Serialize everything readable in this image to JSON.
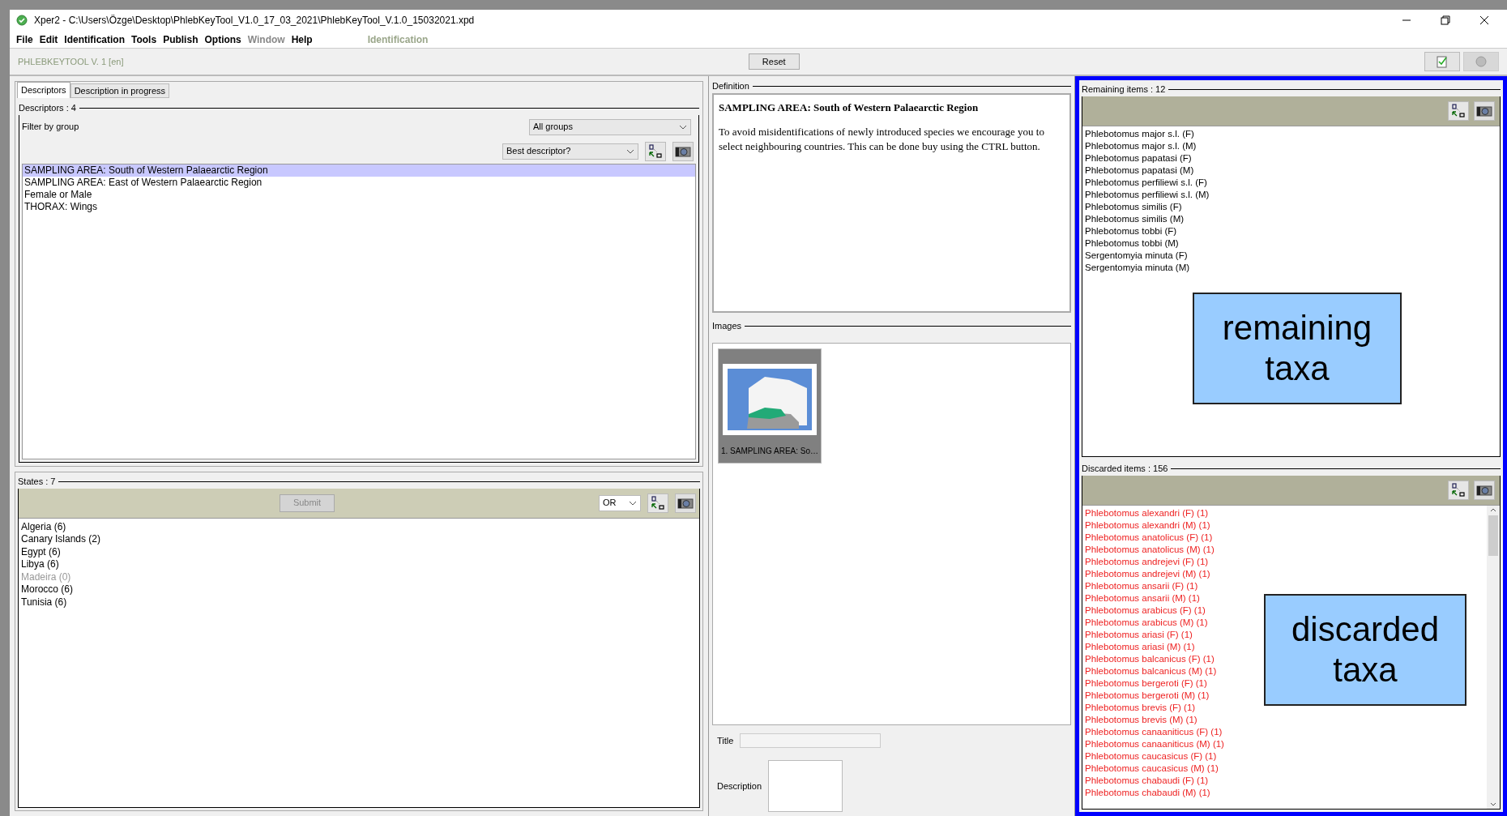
{
  "window": {
    "title": "Xper2 - C:\\Users\\Özge\\Desktop\\PhlebKeyTool_V1.0_17_03_2021\\PhlebKeyTool_V.1.0_15032021.xpd"
  },
  "menu": [
    {
      "label": "File",
      "disabled": false
    },
    {
      "label": "Edit",
      "disabled": false
    },
    {
      "label": "Identification",
      "disabled": false
    },
    {
      "label": "Tools",
      "disabled": false
    },
    {
      "label": "Publish",
      "disabled": false
    },
    {
      "label": "Options",
      "disabled": false
    },
    {
      "label": "Window",
      "disabled": true
    },
    {
      "label": "Help",
      "disabled": false
    }
  ],
  "mode": "Identification",
  "toolbar": {
    "project": "PHLEBKEYTOOL V. 1 [en]",
    "reset": "Reset"
  },
  "tabs": [
    {
      "label": "Descriptors",
      "selected": true
    },
    {
      "label": "Description in progress",
      "selected": false
    }
  ],
  "descriptors": {
    "legend": "Descriptors : 4",
    "filter_label": "Filter by group",
    "group_select": "All groups",
    "sort_select": "Best descriptor?",
    "items": [
      {
        "label": "SAMPLING AREA: South of Western Palaearctic Region",
        "selected": true
      },
      {
        "label": "SAMPLING AREA: East of Western Palaearctic Region",
        "selected": false
      },
      {
        "label": "Female or Male",
        "selected": false
      },
      {
        "label": "THORAX: Wings",
        "selected": false
      }
    ]
  },
  "states": {
    "legend": "States : 7",
    "submit": {
      "label": "Submit",
      "disabled": true
    },
    "operator": "OR",
    "items": [
      {
        "label": "Algeria (6)",
        "disabled": false
      },
      {
        "label": "Canary Islands (2)",
        "disabled": false
      },
      {
        "label": "Egypt (6)",
        "disabled": false
      },
      {
        "label": "Libya (6)",
        "disabled": false
      },
      {
        "label": "Madeira (0)",
        "disabled": true
      },
      {
        "label": "Morocco (6)",
        "disabled": false
      },
      {
        "label": "Tunisia (6)",
        "disabled": false
      }
    ]
  },
  "definition": {
    "legend": "Definition",
    "heading": "SAMPLING AREA: South of Western Palaearctic Region",
    "body": "To avoid misidentifications of newly introduced species we encourage you to select neighbouring countries. This can be done buy using the CTRL button."
  },
  "images": {
    "legend": "Images",
    "thumbnails": [
      {
        "caption": "1. SAMPLING AREA: So…"
      }
    ],
    "title_label": "Title",
    "description_label": "Description"
  },
  "remaining": {
    "legend": "Remaining items : 12",
    "annotation": "remaining taxa",
    "items": [
      "Phlebotomus major s.l. (F)",
      "Phlebotomus major s.l. (M)",
      "Phlebotomus papatasi (F)",
      "Phlebotomus papatasi (M)",
      "Phlebotomus perfiliewi s.l. (F)",
      "Phlebotomus perfiliewi s.l. (M)",
      "Phlebotomus similis (F)",
      "Phlebotomus similis (M)",
      "Phlebotomus tobbi (F)",
      "Phlebotomus tobbi (M)",
      "Sergentomyia minuta (F)",
      "Sergentomyia minuta (M)"
    ]
  },
  "discarded": {
    "legend": "Discarded items : 156",
    "annotation": "discarded taxa",
    "items": [
      "Phlebotomus alexandri (F) (1)",
      "Phlebotomus alexandri (M) (1)",
      "Phlebotomus anatolicus (F) (1)",
      "Phlebotomus anatolicus (M) (1)",
      "Phlebotomus andrejevi (F) (1)",
      "Phlebotomus andrejevi (M) (1)",
      "Phlebotomus ansarii (F) (1)",
      "Phlebotomus ansarii (M) (1)",
      "Phlebotomus arabicus (F) (1)",
      "Phlebotomus arabicus (M) (1)",
      "Phlebotomus ariasi (F) (1)",
      "Phlebotomus ariasi (M) (1)",
      "Phlebotomus balcanicus (F) (1)",
      "Phlebotomus balcanicus (M) (1)",
      "Phlebotomus bergeroti (F) (1)",
      "Phlebotomus bergeroti (M) (1)",
      "Phlebotomus brevis (F) (1)",
      "Phlebotomus brevis (M) (1)",
      "Phlebotomus canaaniticus (F) (1)",
      "Phlebotomus canaaniticus (M) (1)",
      "Phlebotomus caucasicus (F) (1)",
      "Phlebotomus caucasicus (M) (1)",
      "Phlebotomus chabaudi (F) (1)",
      "Phlebotomus chabaudi (M) (1)"
    ]
  }
}
